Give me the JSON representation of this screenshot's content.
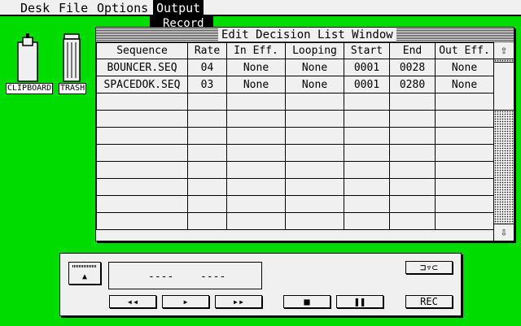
{
  "menubar": {
    "items": [
      "Desk",
      "File",
      "Options",
      "Output"
    ]
  },
  "dropdown": {
    "items": [
      "Record"
    ]
  },
  "desktop": {
    "icons": [
      {
        "label": "CLIPBOARD",
        "icon": "clipboard-icon"
      },
      {
        "label": "TRASH",
        "icon": "trash-icon"
      }
    ]
  },
  "window": {
    "title": "Edit Decision List Window",
    "columns": [
      "Sequence",
      "Rate",
      "In Eff.",
      "Looping",
      "Start",
      "End",
      "Out Eff."
    ],
    "rows": [
      [
        "BOUNCER.SEQ",
        "04",
        "None",
        "None",
        "0001",
        "0028",
        "None"
      ],
      [
        "SPACEDOK.SEQ",
        "03",
        "None",
        "None",
        "0001",
        "0280",
        "None"
      ],
      [
        "",
        "",
        "",
        "",
        "",
        "",
        ""
      ],
      [
        "",
        "",
        "",
        "",
        "",
        "",
        ""
      ],
      [
        "",
        "",
        "",
        "",
        "",
        "",
        ""
      ],
      [
        "",
        "",
        "",
        "",
        "",
        "",
        ""
      ],
      [
        "",
        "",
        "",
        "",
        "",
        "",
        ""
      ],
      [
        "",
        "",
        "",
        "",
        "",
        "",
        ""
      ],
      [
        "",
        "",
        "",
        "",
        "",
        "",
        ""
      ],
      [
        "",
        "",
        "",
        "",
        "",
        "",
        ""
      ]
    ]
  },
  "transport": {
    "counter_left": "----",
    "counter_right": "----",
    "rewind": "◂◂",
    "play": "▸",
    "ffwd": "▸▸",
    "stop": "■",
    "pause": "❚❚",
    "rec": "REC",
    "video": "⊐▿⊂",
    "eject": "▲"
  }
}
